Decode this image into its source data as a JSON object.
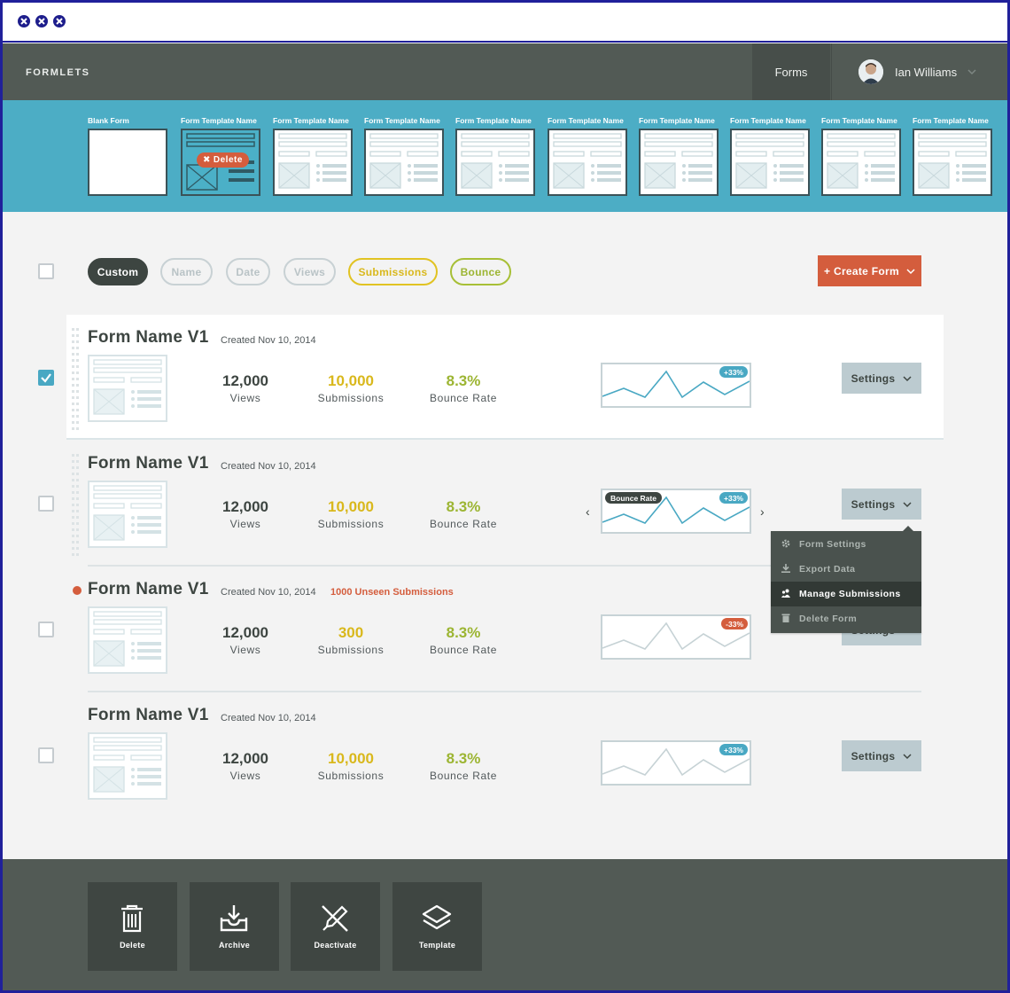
{
  "app": {
    "brand": "FORMLETS",
    "nav_forms": "Forms",
    "user_name": "Ian Williams"
  },
  "templates": {
    "blank_label": "Blank Form",
    "template_label": "Form Template Name",
    "delete_label": "Delete"
  },
  "filters": {
    "custom": "Custom",
    "name": "Name",
    "date": "Date",
    "views": "Views",
    "submissions": "Submissions",
    "bounce": "Bounce"
  },
  "create_button": "+ Create Form",
  "labels": {
    "views": "Views",
    "submissions": "Submissions",
    "bounce_rate": "Bounce Rate",
    "settings": "Settings",
    "hover_tag": "Bounce Rate"
  },
  "forms": [
    {
      "name": "Form Name V1",
      "created": "Created Nov 10, 2014",
      "views": "12,000",
      "submissions": "10,000",
      "bounce": "8.3%",
      "change": "+33%",
      "checked": true
    },
    {
      "name": "Form Name V1",
      "created": "Created Nov 10, 2014",
      "views": "12,000",
      "submissions": "10,000",
      "bounce": "8.3%",
      "change": "+33%",
      "checked": false
    },
    {
      "name": "Form Name V1",
      "created": "Created Nov 10, 2014",
      "unseen": "1000 Unseen Submissions",
      "views": "12,000",
      "submissions": "300",
      "bounce": "8.3%",
      "change": "-33%",
      "checked": false
    },
    {
      "name": "Form Name V1",
      "created": "Created Nov 10, 2014",
      "views": "12,000",
      "submissions": "10,000",
      "bounce": "8.3%",
      "change": "+33%",
      "checked": false
    }
  ],
  "settings_menu": {
    "items": [
      "Form Settings",
      "Export Data",
      "Manage Submissions",
      "Delete Form"
    ],
    "active": "Manage Submissions"
  },
  "actions": [
    "Delete",
    "Archive",
    "Deactivate",
    "Template"
  ],
  "colors": {
    "accent_teal": "#4cadc5",
    "danger": "#d45d3d",
    "submissions_yellow": "#d9b81c",
    "bounce_green": "#9cb532",
    "nav_dark": "#525a55"
  }
}
